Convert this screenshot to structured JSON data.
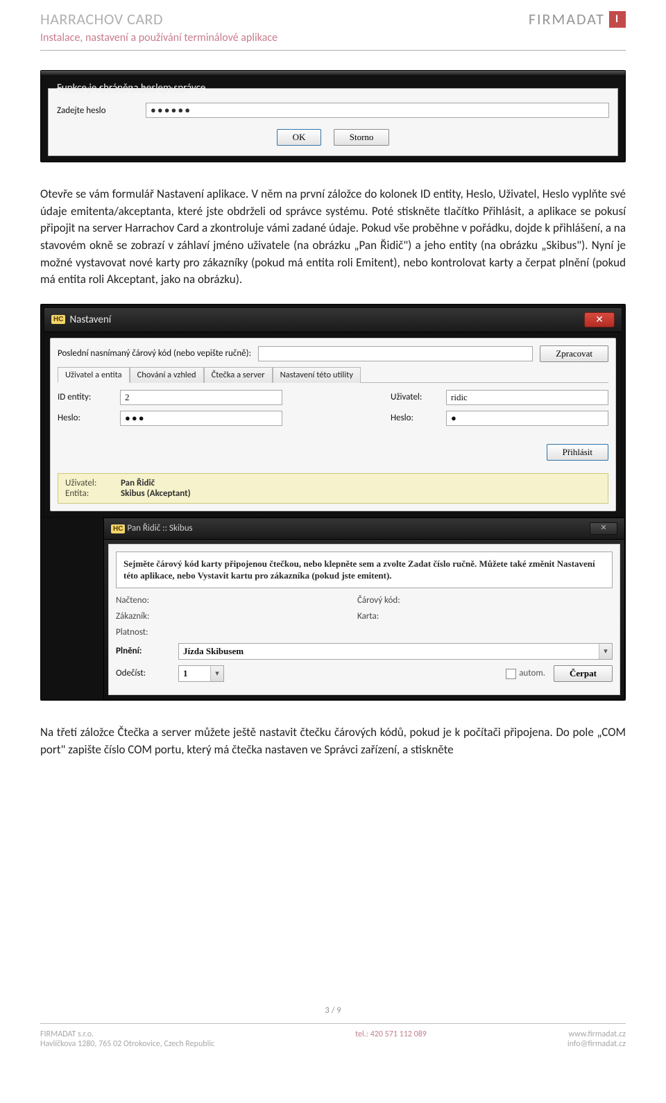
{
  "header": {
    "title": "HARRACHOV CARD",
    "subtitle": "Instalace, nastavení a používání terminálové aplikace",
    "brand": "FIRMADAT",
    "brand_logo_letter": "I"
  },
  "shot1": {
    "frame_label": "Funkce je chráněna heslem správce",
    "pw_label": "Zadejte heslo",
    "pw_value": "●●●●●●",
    "btn_ok": "OK",
    "btn_cancel": "Storno"
  },
  "para1": "Otevře se vám formulář Nastavení aplikace. V něm na první záložce do kolonek ID entity, Heslo, Uživatel, Heslo vyplňte své údaje emitenta/akceptanta, které jste obdrželi od správce systému. Poté stiskněte tlačítko Přihlásit, a aplikace se pokusí připojit na server Harrachov Card a zkontroluje vámi zadané údaje. Pokud vše proběhne v pořádku, dojde k přihlášení, a na stavovém okně se zobrazí v záhlaví jméno uživatele (na obrázku „Pan Řidič\") a jeho entity (na obrázku „Skibus\"). Nyní je možné vystavovat nové karty pro zákazníky (pokud má entita roli Emitent), nebo kontrolovat karty a čerpat plnění (pokud má entita roli Akceptant, jako na obrázku).",
  "shot2": {
    "title_icon": "HC",
    "title": "Nastavení",
    "barcode_label": "Poslední nasnímaný čárový kód (nebo vepište ručně):",
    "btn_process": "Zpracovat",
    "tabs": [
      "Uživatel a entita",
      "Chování a vzhled",
      "Čtečka a server",
      "Nastavení této utility"
    ],
    "id_entity_label": "ID entity:",
    "id_entity_value": "2",
    "heslo_label": "Heslo:",
    "heslo_value": "●●●",
    "uzivatel_label": "Uživatel:",
    "uzivatel_value": "ridic",
    "heslo2_label": "Heslo:",
    "heslo2_value": "●",
    "btn_login": "Přihlásit",
    "status_user_label": "Uživatel:",
    "status_user_value": "Pan Řidič",
    "status_entity_label": "Entita:",
    "status_entity_value": "Skibus (Akceptant)",
    "nest": {
      "title_icon": "HC",
      "title": "Pan Řidič :: Skibus",
      "instructions": "Sejměte čárový kód karty připojenou čtečkou, nebo klepněte sem a zvolte Zadat číslo ručně. Můžete také změnit Nastavení této aplikace, nebo Vystavit kartu pro zákazníka (pokud jste emitent).",
      "nacteno_label": "Načteno:",
      "carovy_label": "Čárový kód:",
      "zakaznik_label": "Zákazník:",
      "karta_label": "Karta:",
      "platnost_label": "Platnost:",
      "plneni_label": "Plnění:",
      "plneni_value": "Jízda Skibusem",
      "odecist_label": "Odečíst:",
      "odecist_value": "1",
      "autom_label": "autom.",
      "btn_draw": "Čerpat"
    }
  },
  "para2": "Na třetí záložce Čtečka a server můžete ještě nastavit čtečku čárových kódů, pokud je k počítači připojena. Do pole „COM port\" zapište číslo COM portu, který má čtečka nastaven ve Správci zařízení, a stiskněte",
  "pagenum": "3 / 9",
  "footer": {
    "company": "FIRMADAT s.r.o.",
    "address": "Havlíčkova 1280, 765 02 Otrokovice, Czech Republic",
    "tel": "tel.: 420 571 112 089",
    "www": "www.firmadat.cz",
    "mail": "info@firmadat.cz"
  }
}
